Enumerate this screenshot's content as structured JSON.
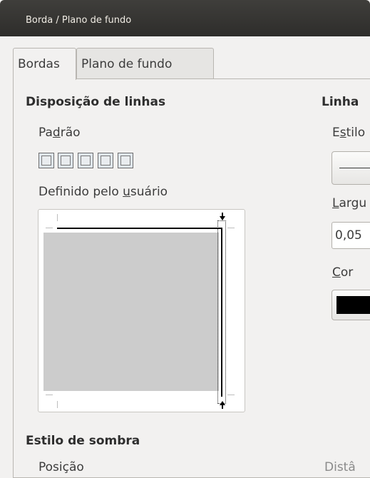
{
  "window": {
    "title": "Borda / Plano de fundo"
  },
  "tabs": [
    {
      "label": "Bordas",
      "active": true
    },
    {
      "label": "Plano de fundo",
      "active": false
    }
  ],
  "line_arrangement": {
    "heading": "Disposição de linhas",
    "default_label": "Padrão",
    "user_defined_label": "Definido pelo usuário",
    "presets": [
      "none",
      "box",
      "outer",
      "inner",
      "diagonal"
    ]
  },
  "line": {
    "heading": "Linha",
    "style_label": "Estilo",
    "width_label": "Largu",
    "width_value": "0,05",
    "color_label": "Cor",
    "color_value": "#000000"
  },
  "shadow": {
    "heading": "Estilo de sombra",
    "position_label": "Posição",
    "distance_label": "Distâ"
  }
}
